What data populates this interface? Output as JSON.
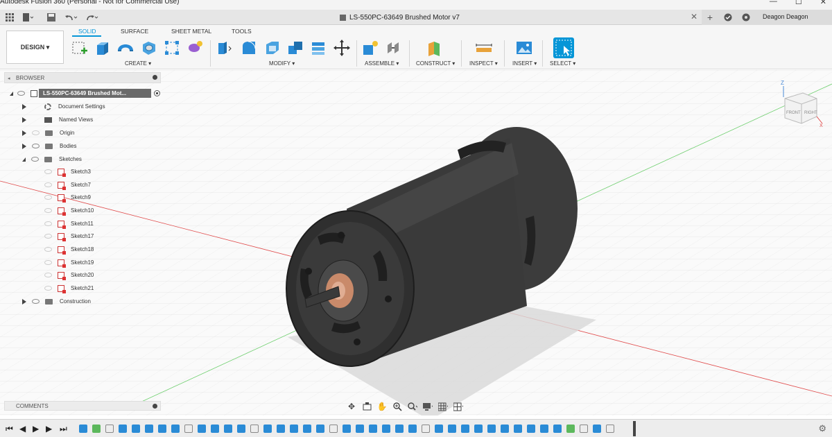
{
  "window": {
    "title": "Autodesk Fusion 360 (Personal - Not for Commercial Use)",
    "minimize": "—",
    "maximize": "☐",
    "close": "✕"
  },
  "quick_access": {
    "icons": [
      "apps-grid-icon",
      "file-icon",
      "save-icon",
      "undo-icon",
      "redo-icon"
    ],
    "document_tab": "LS-550PC-63649 Brushed Motor v7",
    "tab_close": "✕",
    "user": "Deagon Deagon"
  },
  "toolbar": {
    "workspace_button": "DESIGN ▾",
    "tabs": [
      "SOLID",
      "SURFACE",
      "SHEET METAL",
      "TOOLS"
    ],
    "active_tab": "SOLID",
    "groups": {
      "create": "CREATE ▾",
      "modify": "MODIFY ▾",
      "assemble": "ASSEMBLE ▾",
      "construct": "CONSTRUCT ▾",
      "inspect": "INSPECT ▾",
      "insert": "INSERT ▾",
      "select": "SELECT ▾"
    }
  },
  "browser": {
    "header": "BROWSER",
    "root": "LS-550PC-63649 Brushed Mot...",
    "items": [
      {
        "label": "Document Settings"
      },
      {
        "label": "Named Views"
      },
      {
        "label": "Origin"
      },
      {
        "label": "Bodies"
      },
      {
        "label": "Sketches"
      },
      {
        "label": "Construction"
      }
    ],
    "sketches": [
      "Sketch3",
      "Sketch7",
      "Sketch9",
      "Sketch10",
      "Sketch11",
      "Sketch17",
      "Sketch18",
      "Sketch19",
      "Sketch20",
      "Sketch21"
    ]
  },
  "comments": {
    "header": "COMMENTS"
  },
  "viewcube": {
    "front": "FRONT",
    "right": "RIGHT",
    "axis_z": "Z",
    "axis_x": "X"
  },
  "colors": {
    "accent": "#0696d7",
    "motor_body": "#3a3a3a",
    "copper": "#c98a6a"
  }
}
